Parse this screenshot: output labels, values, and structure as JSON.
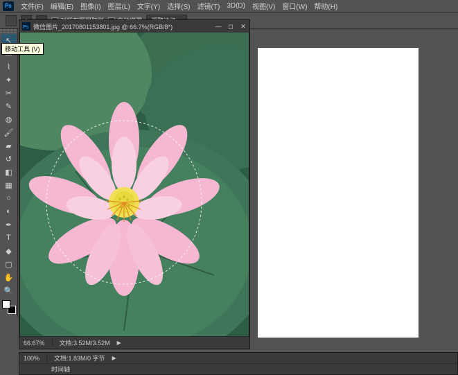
{
  "menubar": {
    "items": [
      "文件(F)",
      "编辑(E)",
      "图像(I)",
      "图层(L)",
      "文字(Y)",
      "选择(S)",
      "滤镜(T)",
      "3D(D)",
      "视图(V)",
      "窗口(W)",
      "帮助(H)"
    ]
  },
  "options": {
    "check1": "对所有图层取样",
    "check2": "自动增强",
    "btn": "调整边缘…"
  },
  "tooltip": "移动工具 (V)",
  "doc1": {
    "title": "微信图片_20170801153801.jpg @ 66.7%(RGB/8*)",
    "zoom": "66.67%",
    "status": "文档:3.52M/3.52M"
  },
  "doc2": {
    "zoom": "100%",
    "status": "文档:1.83M/0 字节",
    "timeline": "时间轴"
  },
  "tools": [
    {
      "name": "move",
      "glyph": "↖",
      "sel": true
    },
    {
      "name": "marquee",
      "glyph": "▭"
    },
    {
      "name": "lasso",
      "glyph": "⌇"
    },
    {
      "name": "quick-select",
      "glyph": "✦"
    },
    {
      "name": "crop",
      "glyph": "✂"
    },
    {
      "name": "eyedropper",
      "glyph": "✎"
    },
    {
      "name": "spot-heal",
      "glyph": "◍"
    },
    {
      "name": "brush",
      "glyph": "🖌"
    },
    {
      "name": "stamp",
      "glyph": "▰"
    },
    {
      "name": "history-brush",
      "glyph": "↺"
    },
    {
      "name": "eraser",
      "glyph": "◧"
    },
    {
      "name": "gradient",
      "glyph": "▦"
    },
    {
      "name": "blur",
      "glyph": "○"
    },
    {
      "name": "dodge",
      "glyph": "◐"
    },
    {
      "name": "pen",
      "glyph": "✒"
    },
    {
      "name": "type",
      "glyph": "T"
    },
    {
      "name": "path-select",
      "glyph": "◆"
    },
    {
      "name": "rectangle",
      "glyph": "▢"
    },
    {
      "name": "hand",
      "glyph": "✋"
    },
    {
      "name": "zoom",
      "glyph": "🔍"
    }
  ]
}
